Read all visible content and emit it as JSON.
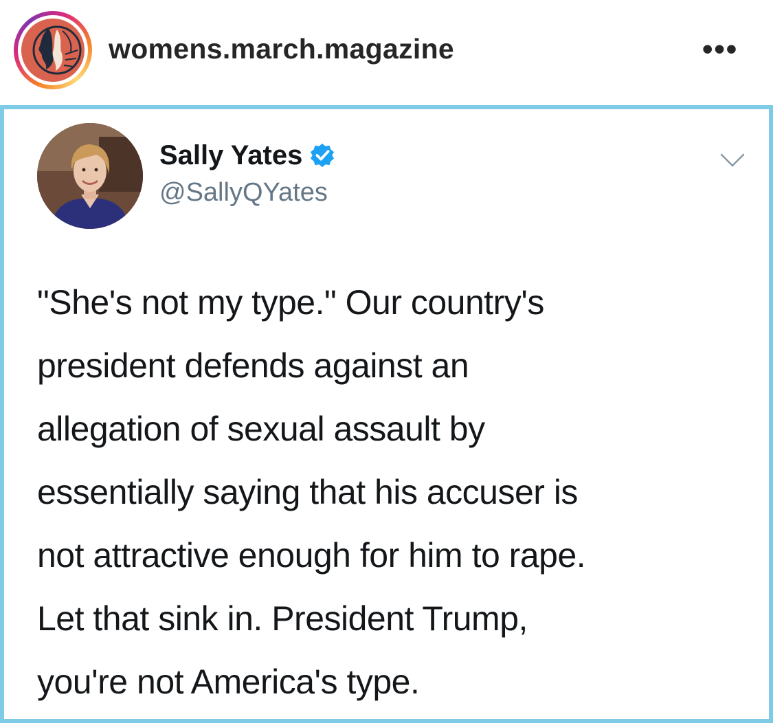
{
  "instagram": {
    "username": "womens.march.magazine",
    "more_glyph": "•••"
  },
  "tweet": {
    "author_name": "Sally Yates",
    "handle": "@SallyQYates",
    "text_lines": [
      "\"She's not my type.\" Our country's",
      "president defends against an",
      "allegation of sexual assault by",
      "essentially saying that his accuser is",
      "not attractive enough for him to rape.",
      "Let that sink in. President Trump,",
      "you're not America's type."
    ]
  },
  "colors": {
    "frame_border": "#7ecbe6",
    "verified_blue": "#1da1f2",
    "handle_gray": "#657786"
  },
  "icons": {
    "profile_avatar": "womens-march-logo-icon",
    "more": "more-options-icon",
    "verified": "verified-badge-icon",
    "menu": "chevron-down-icon"
  }
}
